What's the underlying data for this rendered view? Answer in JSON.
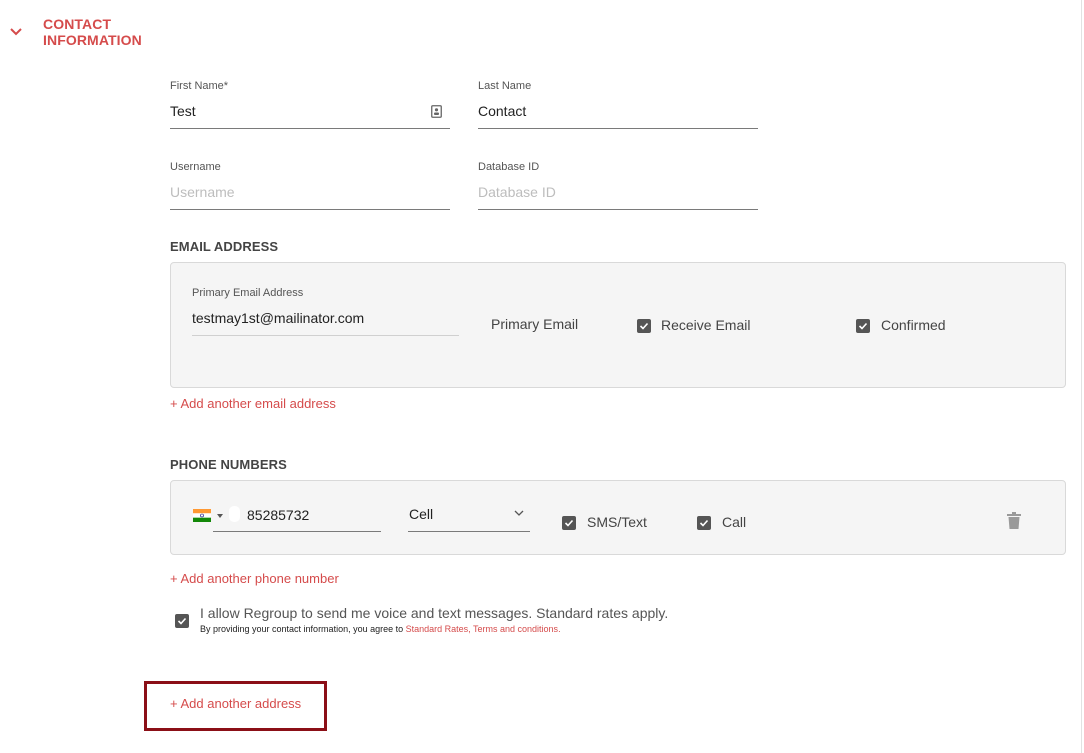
{
  "section": {
    "title_line1": "CONTACT",
    "title_line2": "INFORMATION",
    "chevron_icon": "chevron-down-icon"
  },
  "name_fields": {
    "first_name": {
      "label": "First Name*",
      "value": "Test",
      "icon": "contact-card-icon"
    },
    "last_name": {
      "label": "Last Name",
      "value": "Contact"
    },
    "username": {
      "label": "Username",
      "placeholder": "Username"
    },
    "database_id": {
      "label": "Database ID",
      "placeholder": "Database ID"
    }
  },
  "email": {
    "heading": "EMAIL ADDRESS",
    "field_label": "Primary Email Address",
    "value": "testmay1st@mailinator.com",
    "primary_text": "Primary Email",
    "receive_label": "Receive Email",
    "receive_checked": true,
    "confirmed_label": "Confirmed",
    "confirmed_checked": true,
    "add_link": "+ Add another email address"
  },
  "phone": {
    "heading": "PHONE NUMBERS",
    "country_flag": "india-flag-icon",
    "number": "85285732",
    "type": "Cell",
    "sms_label": "SMS/Text",
    "sms_checked": true,
    "call_label": "Call",
    "call_checked": true,
    "delete_icon": "trash-icon",
    "add_link": "+ Add another phone number"
  },
  "consent": {
    "checked": true,
    "text": "I allow Regroup to send me voice and text messages. Standard rates apply.",
    "small_prefix": "By providing your contact information, you agree to ",
    "link_rates": "Standard Rates",
    "separator": ", ",
    "link_terms": "Terms and conditions",
    "suffix": "."
  },
  "address": {
    "add_link": "+ Add another address"
  },
  "colors": {
    "accent": "#d54b4b",
    "highlight": "#8b0f17",
    "checkbox": "#555555",
    "panel_bg": "#f5f5f5"
  }
}
